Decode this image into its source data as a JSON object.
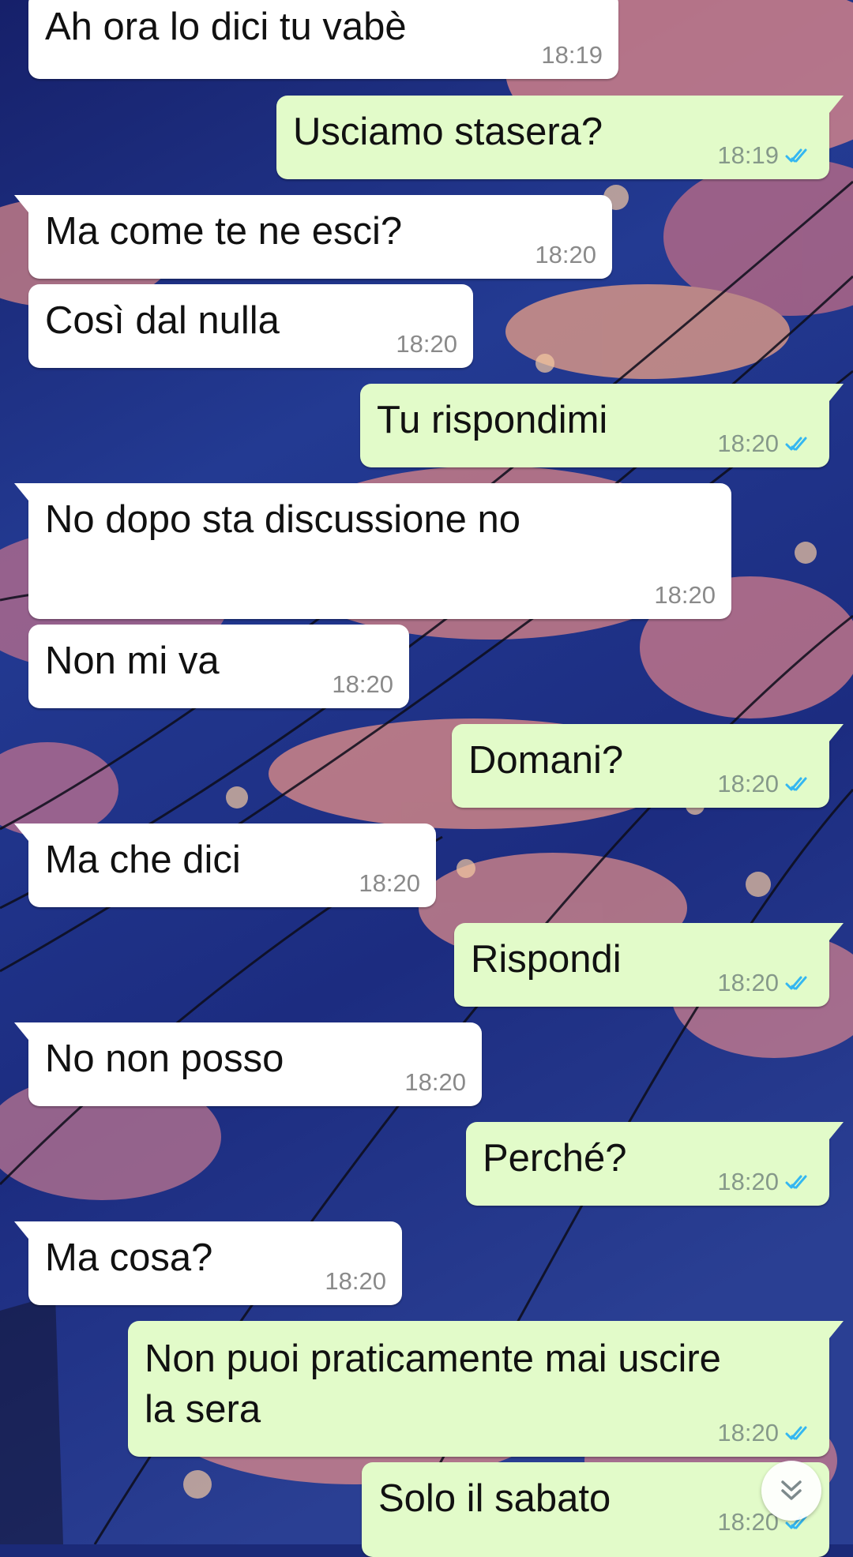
{
  "colors": {
    "incoming_bubble": "#ffffff",
    "outgoing_bubble": "#e2fbc9",
    "read_ticks": "#34b7f1",
    "timestamp": "#8a8a8a"
  },
  "messages": [
    {
      "direction": "in",
      "text": "Ah ora lo dici tu vabè",
      "time": "18:19",
      "ticks": ""
    },
    {
      "direction": "out",
      "text": "Usciamo stasera?",
      "time": "18:19",
      "ticks": "read"
    },
    {
      "direction": "in",
      "text": "Ma come te ne esci?",
      "time": "18:20",
      "ticks": ""
    },
    {
      "direction": "in",
      "text": "Così dal nulla",
      "time": "18:20",
      "ticks": ""
    },
    {
      "direction": "out",
      "text": "Tu rispondimi",
      "time": "18:20",
      "ticks": "read"
    },
    {
      "direction": "in",
      "text": "No dopo sta discussione no",
      "time": "18:20",
      "ticks": ""
    },
    {
      "direction": "in",
      "text": "Non mi va",
      "time": "18:20",
      "ticks": ""
    },
    {
      "direction": "out",
      "text": "Domani?",
      "time": "18:20",
      "ticks": "read"
    },
    {
      "direction": "in",
      "text": "Ma che dici",
      "time": "18:20",
      "ticks": ""
    },
    {
      "direction": "out",
      "text": "Rispondi",
      "time": "18:20",
      "ticks": "read"
    },
    {
      "direction": "in",
      "text": "No non posso",
      "time": "18:20",
      "ticks": ""
    },
    {
      "direction": "out",
      "text": "Perché?",
      "time": "18:20",
      "ticks": "read"
    },
    {
      "direction": "in",
      "text": "Ma cosa?",
      "time": "18:20",
      "ticks": ""
    },
    {
      "direction": "out",
      "text": "Non puoi praticamente mai uscire\nla sera",
      "time": "18:20",
      "ticks": "read"
    },
    {
      "direction": "out",
      "text": "Solo il sabato",
      "time": "18:20",
      "ticks": "read"
    }
  ],
  "scroll_button": {
    "icon": "double-chevron-down-icon"
  }
}
